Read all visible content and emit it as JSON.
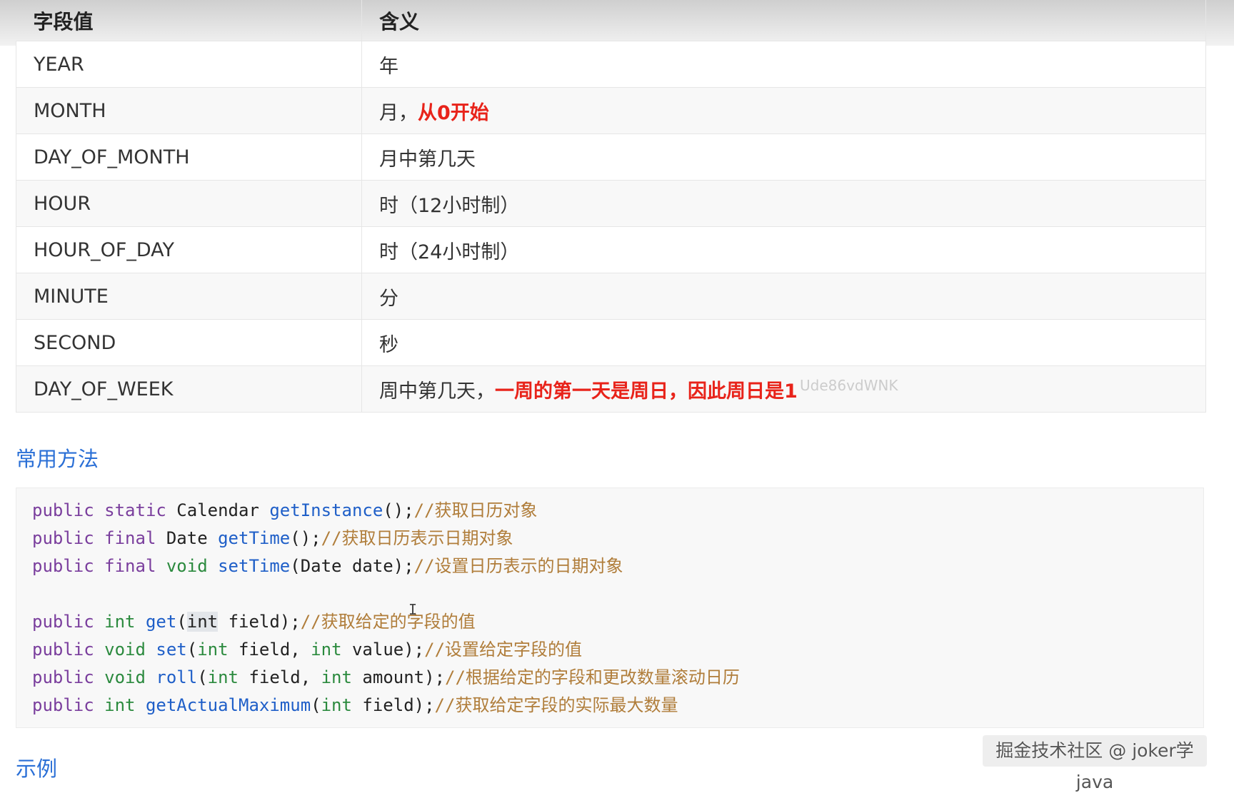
{
  "table": {
    "headers": [
      "字段值",
      "含义"
    ],
    "rows": [
      {
        "field": "YEAR",
        "meaning": "年",
        "highlight": ""
      },
      {
        "field": "MONTH",
        "meaning": "月，",
        "highlight": "从0开始"
      },
      {
        "field": "DAY_OF_MONTH",
        "meaning": "月中第几天",
        "highlight": ""
      },
      {
        "field": "HOUR",
        "meaning": "时（12小时制）",
        "highlight": ""
      },
      {
        "field": "HOUR_OF_DAY",
        "meaning": "时（24小时制）",
        "highlight": ""
      },
      {
        "field": "MINUTE",
        "meaning": "分",
        "highlight": ""
      },
      {
        "field": "SECOND",
        "meaning": "秒",
        "highlight": ""
      },
      {
        "field": "DAY_OF_WEEK",
        "meaning": "周中第几天，",
        "highlight": "一周的第一天是周日，因此周日是1"
      }
    ],
    "watermark": "Ude86vdWNK"
  },
  "sections": {
    "methods_title": "常用方法",
    "example_title": "示例"
  },
  "code": {
    "lines": [
      [
        {
          "t": "public static ",
          "c": "kw"
        },
        {
          "t": "Calendar ",
          "c": ""
        },
        {
          "t": "getInstance",
          "c": "fn"
        },
        {
          "t": "();",
          "c": ""
        },
        {
          "t": "//获取日历对象",
          "c": "cm"
        }
      ],
      [
        {
          "t": "public final ",
          "c": "kw"
        },
        {
          "t": "Date ",
          "c": ""
        },
        {
          "t": "getTime",
          "c": "fn"
        },
        {
          "t": "();",
          "c": ""
        },
        {
          "t": "//获取日历表示日期对象",
          "c": "cm"
        }
      ],
      [
        {
          "t": "public final ",
          "c": "kw"
        },
        {
          "t": "void ",
          "c": "ty"
        },
        {
          "t": "setTime",
          "c": "fn"
        },
        {
          "t": "(Date date);",
          "c": ""
        },
        {
          "t": "//设置日历表示的日期对象",
          "c": "cm"
        }
      ],
      [],
      [
        {
          "t": "public ",
          "c": "kw"
        },
        {
          "t": "int ",
          "c": "ty"
        },
        {
          "t": "get",
          "c": "fn"
        },
        {
          "t": "(",
          "c": ""
        },
        {
          "t": "int",
          "c": "hl"
        },
        {
          "t": " field);",
          "c": ""
        },
        {
          "t": "//获取给定的字段的值",
          "c": "cm"
        }
      ],
      [
        {
          "t": "public ",
          "c": "kw"
        },
        {
          "t": "void ",
          "c": "ty"
        },
        {
          "t": "set",
          "c": "fn"
        },
        {
          "t": "(",
          "c": ""
        },
        {
          "t": "int",
          "c": "ty"
        },
        {
          "t": " field, ",
          "c": ""
        },
        {
          "t": "int",
          "c": "ty"
        },
        {
          "t": " value);",
          "c": ""
        },
        {
          "t": "//设置给定字段的值",
          "c": "cm"
        }
      ],
      [
        {
          "t": "public ",
          "c": "kw"
        },
        {
          "t": "void ",
          "c": "ty"
        },
        {
          "t": "roll",
          "c": "fn"
        },
        {
          "t": "(",
          "c": ""
        },
        {
          "t": "int",
          "c": "ty"
        },
        {
          "t": " field, ",
          "c": ""
        },
        {
          "t": "int",
          "c": "ty"
        },
        {
          "t": " amount);",
          "c": ""
        },
        {
          "t": "//根据给定的字段和更改数量滚动日历",
          "c": "cm"
        }
      ],
      [
        {
          "t": "public ",
          "c": "kw"
        },
        {
          "t": "int ",
          "c": "ty"
        },
        {
          "t": "getActualMaximum",
          "c": "fn"
        },
        {
          "t": "(",
          "c": ""
        },
        {
          "t": "int",
          "c": "ty"
        },
        {
          "t": " field);",
          "c": ""
        },
        {
          "t": "//获取给定字段的实际最大数量",
          "c": "cm"
        }
      ]
    ]
  },
  "badge": {
    "text": "掘金技术社区 @ joker学java"
  },
  "colors": {
    "emphasis": "#e8231a",
    "link": "#2a6fd6",
    "keyword": "#7a3e9d",
    "type": "#2b8a3e",
    "function": "#1f5fc8",
    "comment": "#b07d3a"
  }
}
